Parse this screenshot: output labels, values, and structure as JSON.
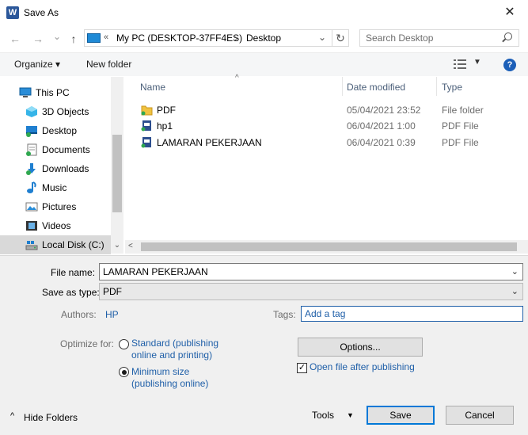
{
  "window": {
    "title": "Save As",
    "app_icon_letter": "W",
    "close_glyph": "✕"
  },
  "navigation": {
    "back": "←",
    "forward": "→",
    "recent_dropdown": "⌄",
    "up": "↑"
  },
  "address": {
    "overflow": "«",
    "segment1": "My PC (DESKTOP-37FF4ES)",
    "separator": "›",
    "segment2": "Desktop",
    "dropdown": "⌄",
    "refresh": "↻"
  },
  "search": {
    "placeholder": "Search Desktop"
  },
  "toolbar": {
    "organize": "Organize ▾",
    "new_folder": "New folder",
    "view_dropdown": "▼",
    "help": "?"
  },
  "nav_pane": {
    "items": [
      {
        "label": "This PC",
        "icon": "this-pc-icon"
      },
      {
        "label": "3D Objects",
        "icon": "3d-objects-icon"
      },
      {
        "label": "Desktop",
        "icon": "desktop-icon"
      },
      {
        "label": "Documents",
        "icon": "documents-icon"
      },
      {
        "label": "Downloads",
        "icon": "downloads-icon"
      },
      {
        "label": "Music",
        "icon": "music-icon"
      },
      {
        "label": "Pictures",
        "icon": "pictures-icon"
      },
      {
        "label": "Videos",
        "icon": "videos-icon"
      },
      {
        "label": "Local Disk (C:)",
        "icon": "local-disk-icon"
      }
    ],
    "scroll_down": "⌄"
  },
  "file_list": {
    "columns": {
      "name": "Name",
      "date": "Date modified",
      "type": "Type"
    },
    "sort_glyph": "^",
    "rows": [
      {
        "name": "PDF",
        "date": "05/04/2021 23:52",
        "type": "File folder"
      },
      {
        "name": "hp1",
        "date": "06/04/2021 1:00",
        "type": "PDF File"
      },
      {
        "name": "LAMARAN PEKERJAAN",
        "date": "06/04/2021 0:39",
        "type": "PDF File"
      }
    ],
    "hscroll_left": "<"
  },
  "form": {
    "file_name_label": "File name:",
    "file_name_value": "LAMARAN PEKERJAAN",
    "save_type_label": "Save as type:",
    "save_type_value": "PDF",
    "dropdown_glyph": "⌄",
    "authors_label": "Authors:",
    "authors_value": "HP",
    "tags_label": "Tags:",
    "tags_value": "Add a tag",
    "optimize_label": "Optimize for:",
    "option_standard_line1": "Standard (publishing",
    "option_standard_line2": "online and printing)",
    "option_minimum_line1": "Minimum size",
    "option_minimum_line2": "(publishing online)",
    "options_button": "Options...",
    "open_after_label": "Open file after publishing",
    "checkbox_mark": "✓"
  },
  "footer": {
    "hide_folders": "Hide Folders",
    "hide_caret": "^",
    "tools": "Tools",
    "tools_caret": "▼",
    "save": "Save",
    "cancel": "Cancel"
  }
}
